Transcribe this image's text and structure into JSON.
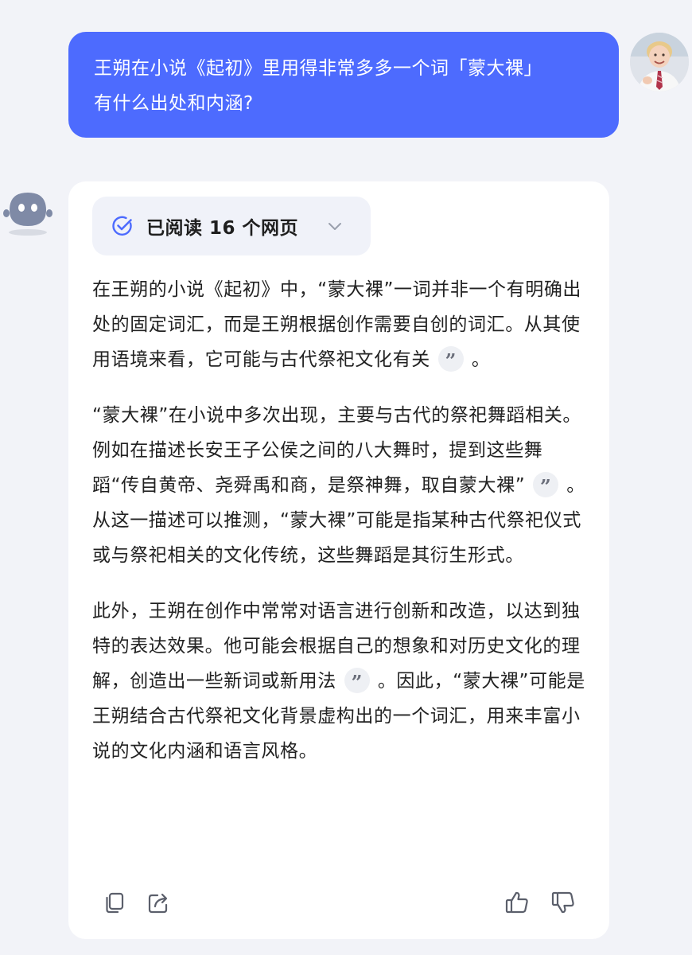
{
  "user_message": {
    "line1": "王朔在小说《起初》里用得非常多多一个词「蒙大裸」",
    "line2": "有什么出处和内涵?"
  },
  "assistant": {
    "sources_label": "已阅读 16 个网页",
    "paragraphs": [
      {
        "parts": [
          "在王朔的小说《起初》中，“蒙大裸”一词并非一个有明确出处的固定词汇，而是王朔根据创作需要自创的词汇。从其使用语境来看，它可能与古代祭祀文化有关",
          "。"
        ]
      },
      {
        "parts": [
          "“蒙大裸”在小说中多次出现，主要与古代的祭祀舞蹈相关。例如在描述长安王子公侯之间的八大舞时，提到这些舞蹈“传自黄帝、尧舜禹和商，是祭神舞，取自蒙大裸”",
          "。从这一描述可以推测，“蒙大裸”可能是指某种古代祭祀仪式或与祭祀相关的文化传统，这些舞蹈是其衍生形式。"
        ]
      },
      {
        "parts": [
          "此外，王朔在创作中常常对语言进行创新和改造，以达到独特的表达效果。他可能会根据自己的想象和对历史文化的理解，创造出一些新词或新用法",
          "。因此，“蒙大裸”可能是王朔结合古代祭祀文化背景虚构出的一个词汇，用来丰富小说的文化内涵和语言风格。"
        ]
      }
    ],
    "citation_glyph": "”",
    "colors": {
      "accent": "#4d6bfe",
      "background": "#f2f3f8",
      "card": "#ffffff",
      "icon": "#5b5f6b"
    },
    "icons": [
      "check-circle-icon",
      "chevron-down-icon",
      "copy-icon",
      "share-icon",
      "thumbs-up-icon",
      "thumbs-down-icon"
    ]
  }
}
